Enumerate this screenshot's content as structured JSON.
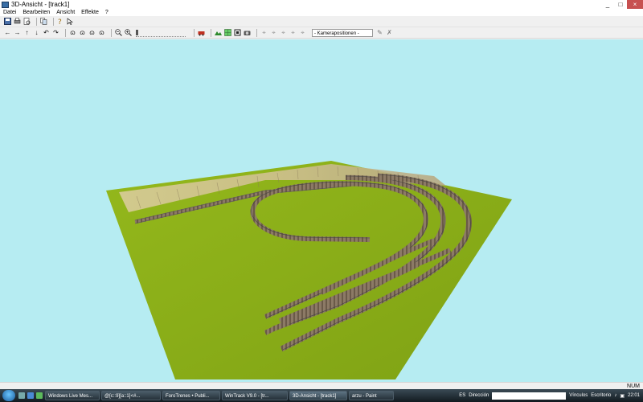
{
  "window": {
    "title": "3D-Ansicht - [track1]",
    "minimize": "_",
    "maximize": "□",
    "close": "×"
  },
  "menu": [
    "Datei",
    "Bearbeiten",
    "Ansicht",
    "Effekte",
    "?"
  ],
  "toolbar2": {
    "camera_select": "- Kamerapositionen -"
  },
  "statusbar": {
    "num": "NUM"
  },
  "taskbar": {
    "items": [
      "Windows Live Mes...",
      "@[c::9][a::1]<#...",
      "ForoTrenes • Publi...",
      "WinTrack V9.0 - [tr...",
      "3D-Ansicht - [track1]",
      "arzu - Paint"
    ],
    "lang": "ES",
    "direccion_label": "Dirección",
    "vinculos_label": "Vínculos",
    "escritorio_label": "Escritorio",
    "clock": "22:01"
  },
  "colors": {
    "sky": "#b6ecf2",
    "ground": "#8aae18",
    "track": "#8c7a66"
  }
}
